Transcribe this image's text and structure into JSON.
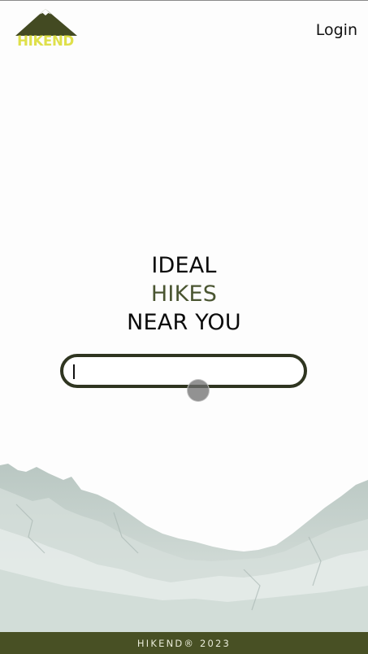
{
  "header": {
    "logo_text": "HIKEND",
    "login_label": "Login"
  },
  "hero": {
    "line1": "IDEAL",
    "line2": "HIKES",
    "line3": "NEAR YOU"
  },
  "search": {
    "value": "",
    "placeholder": ""
  },
  "footer": {
    "text": "HIKEND® 2023"
  },
  "colors": {
    "brand_dark": "#485024",
    "brand_accent_text": "#4a5531",
    "logo_yellow": "#dfe04a",
    "search_border": "#2f3520"
  }
}
